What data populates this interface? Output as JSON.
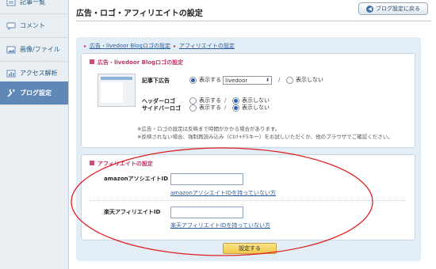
{
  "sidebar": {
    "items": [
      {
        "label": "記事一覧",
        "icon": "article-list-icon"
      },
      {
        "label": "コメント",
        "icon": "comment-icon"
      },
      {
        "label": "画像/ファイル",
        "icon": "image-icon"
      },
      {
        "label": "アクセス解析",
        "icon": "chart-icon"
      },
      {
        "label": "ブログ設定",
        "icon": "wrench-icon"
      }
    ]
  },
  "header": {
    "title": "広告・ロゴ・アフィリエイトの設定",
    "back_label": "ブログ設定に戻る"
  },
  "breadcrumb": {
    "link1": "広告・livedoor Blogロゴの設定",
    "link2": "アフィリエイトの設定"
  },
  "ad_section": {
    "title": "広告・livedoor Blogロゴの設定",
    "article_ad_label": "記事下広告",
    "show": "表示する",
    "hide": "表示しない",
    "select_value": "livedoor",
    "slash": "/",
    "header_logo_label": "ヘッダーロゴ",
    "sidebar_logo_label": "サイドバーロゴ",
    "note1": "※広告・ロゴの設定は反映まで時間がかかる場合があります。",
    "note2": "※反映されない場合、強制再読み込み（Ctrl+F5キー）をお試しいただくか、他のブラウザでご確認ください。"
  },
  "affiliate_section": {
    "title": "アフィリエイトの設定",
    "amazon_label": "amazonアソシエイトID",
    "amazon_value": "",
    "amazon_link": "amazonアソシエイトIDを持っていない方",
    "rakuten_label": "楽天アフィリエイトID",
    "rakuten_value": "",
    "rakuten_link": "楽天アフィリエイトIDを持っていない方"
  },
  "submit_label": "設定する",
  "colors": {
    "accent_pink": "#c0306a",
    "sidebar_active": "#5f88b6",
    "annotation_red": "#e02020"
  }
}
